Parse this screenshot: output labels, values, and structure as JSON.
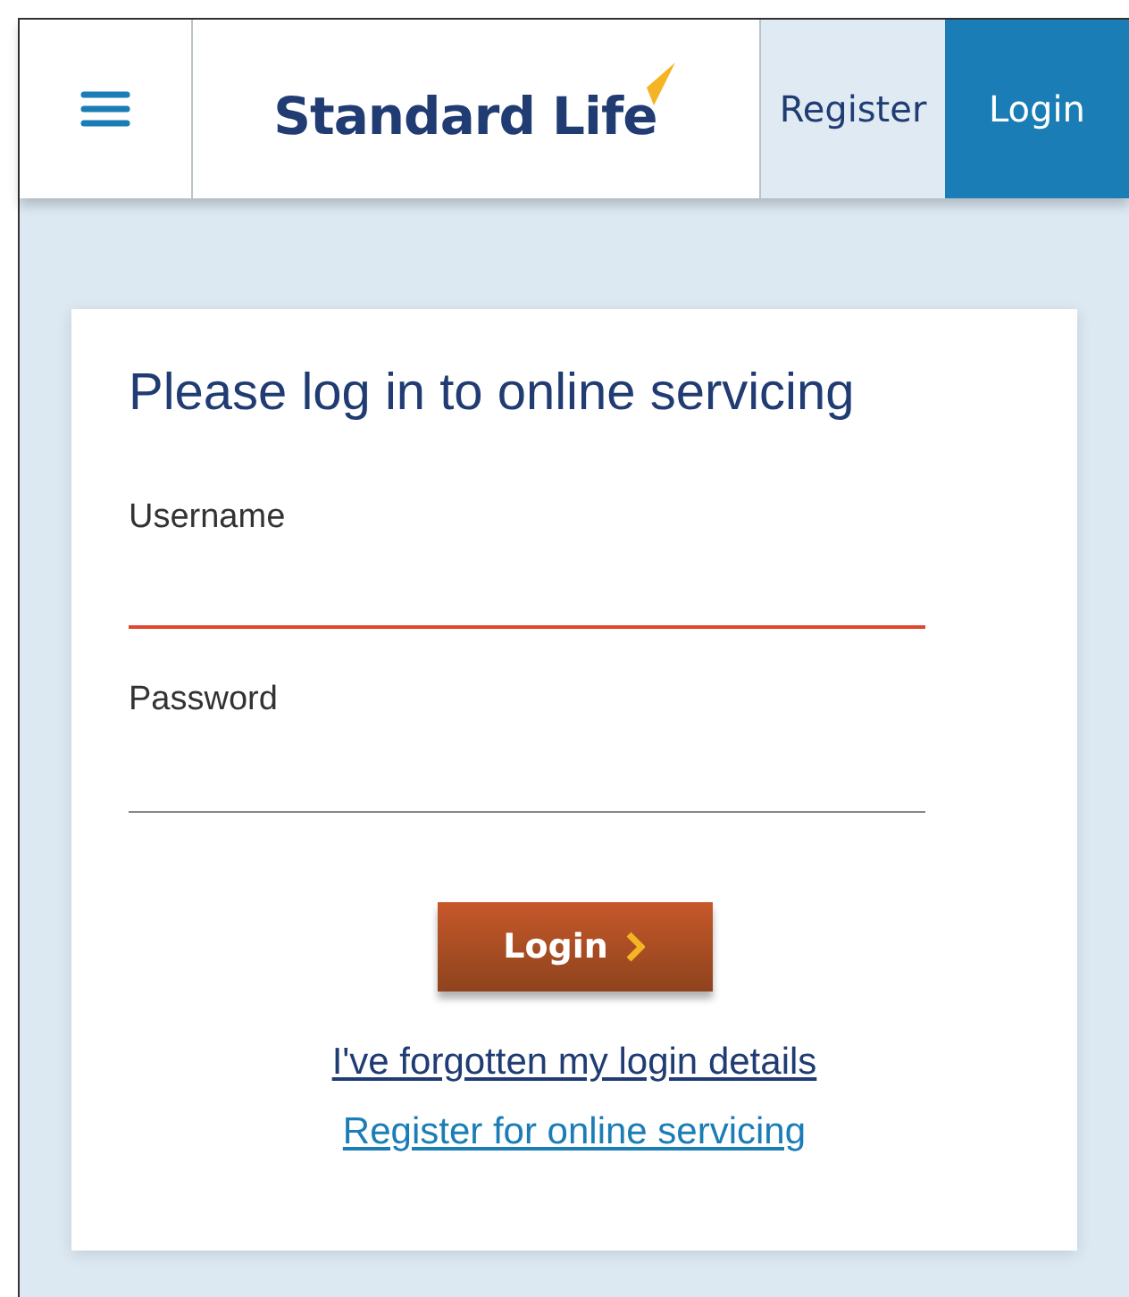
{
  "header": {
    "logo": "Standard Life",
    "nav": [
      {
        "label": "Register",
        "selected": false
      },
      {
        "label": "Login",
        "selected": true
      }
    ]
  },
  "form": {
    "title": "Please log in to online servicing",
    "fields": [
      {
        "label": "Username",
        "focused": true
      },
      {
        "label": "Password",
        "focused": false
      }
    ],
    "submit": "Login",
    "links": [
      {
        "label": "I've forgotten my login details",
        "kind": "primary"
      },
      {
        "label": "Register for online servicing",
        "kind": "secondary"
      }
    ]
  }
}
